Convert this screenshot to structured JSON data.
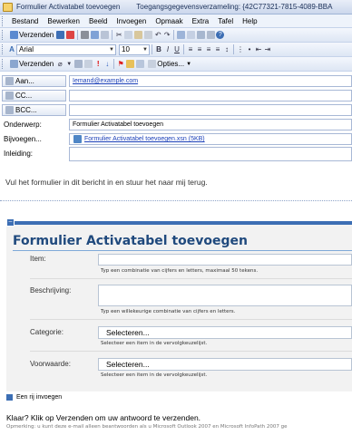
{
  "window": {
    "title_doc": "Formulier Activatabel toevoegen",
    "title_rest": "Toegangsgegevensverzameling: {42C77321-7815-4089-BBA"
  },
  "menu": [
    "Bestand",
    "Bewerken",
    "Beeld",
    "Invoegen",
    "Opmaak",
    "Extra",
    "Tafel",
    "Help"
  ],
  "toolbar1": {
    "send_label": "Verzenden"
  },
  "toolbar2": {
    "font_name": "Arial",
    "font_size": "10"
  },
  "toolbar3": {
    "send_label": "Verzenden",
    "options_label": "Opties..."
  },
  "header": {
    "to_label": "Aan...",
    "to_value": "Iemand@example.com",
    "cc_label": "CC...",
    "cc_value": "",
    "bcc_label": "BCC...",
    "bcc_value": "",
    "subject_label": "Onderwerp:",
    "subject_value": "Formulier Activatabel toevoegen",
    "attach_label": "Bijvoegen...",
    "attach_value": "Formulier Activatabel toevoegen.xsn (5KB)",
    "intro_label": "Inleiding:",
    "intro_value": ""
  },
  "intro_text": "Vul het formulier in dit bericht in en stuur het naar mij terug.",
  "form": {
    "title": "Formulier Activatabel toevoegen",
    "item_label": "Item:",
    "item_hint": "Typ een combinatie van cijfers en letters, maximaal 50 tekens.",
    "desc_label": "Beschrijving:",
    "desc_hint": "Typ een willekeurige combinatie van cijfers en letters.",
    "cat_label": "Categorie:",
    "cat_value": "Selecteren...",
    "cat_hint": "Selecteer een item in de vervolgkeuzelijst.",
    "cond_label": "Voorwaarde:",
    "cond_value": "Selecteren...",
    "cond_hint": "Selecteer een item in de vervolgkeuzelijst.",
    "add_row": "Een rij invoegen"
  },
  "footer": {
    "main": "Klaar? Klik op Verzenden om uw antwoord te verzenden.",
    "note": "Opmerking: u kunt deze e-mail alleen beantwoorden als u Microsoft Outlook 2007 en Microsoft InfoPath 2007 ge"
  }
}
